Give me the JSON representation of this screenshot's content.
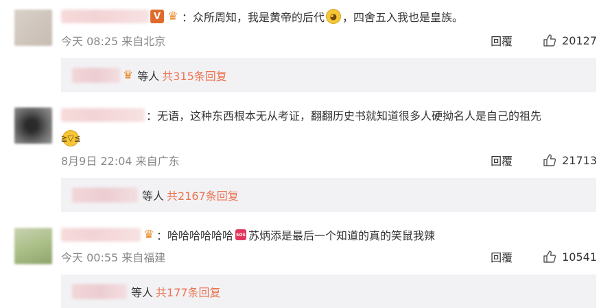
{
  "comments": [
    {
      "avatar_color": "#d2c8bf",
      "text": "：众所周知，我是黄帝的后代",
      "text_after": "，四舍五入我也是皇族。",
      "time": "今天 08:25 来自北京",
      "reply_label": "回覆",
      "likes": "20127",
      "sub": {
        "etc": "等人",
        "total": "共315条回复"
      }
    },
    {
      "avatar_color": "#4a4a4a",
      "text": "：无语，这种东西根本无从考证，翻翻历史书就知道很多人硬拗名人是自己的祖先",
      "time": "8月9日 22:04 来自广东",
      "reply_label": "回覆",
      "likes": "21713",
      "sub": {
        "etc": "等人",
        "total": "共2167条回复"
      }
    },
    {
      "avatar_color": "#b8c79a",
      "text": "：哈哈哈哈哈哈",
      "text_after": "苏炳添是最后一个知道的真的笑鼠我辣",
      "time": "今天 00:55 来自福建",
      "reply_label": "回覆",
      "likes": "10541",
      "sub": {
        "etc": "等人",
        "total": "共177条回复"
      }
    }
  ],
  "icons": {
    "vip_badge": "V",
    "sos_badge": "SOS",
    "crown": "♛",
    "doge": "🐕",
    "laugh_cry": "😂"
  }
}
